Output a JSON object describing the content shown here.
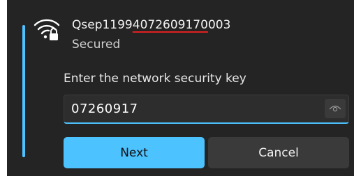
{
  "network": {
    "ssid_prefix": "Qsep1199",
    "ssid_highlight": "4072609170",
    "ssid_suffix": "003",
    "status": "Secured",
    "icon": "wifi-secured-icon"
  },
  "security_key": {
    "prompt": "Enter the network security key",
    "value": "07260917",
    "reveal_icon": "eye-icon"
  },
  "buttons": {
    "next_label": "Next",
    "cancel_label": "Cancel"
  },
  "colors": {
    "accent": "#4cc2ff",
    "panel_bg": "#242424",
    "annotation_underline": "#e02020"
  }
}
